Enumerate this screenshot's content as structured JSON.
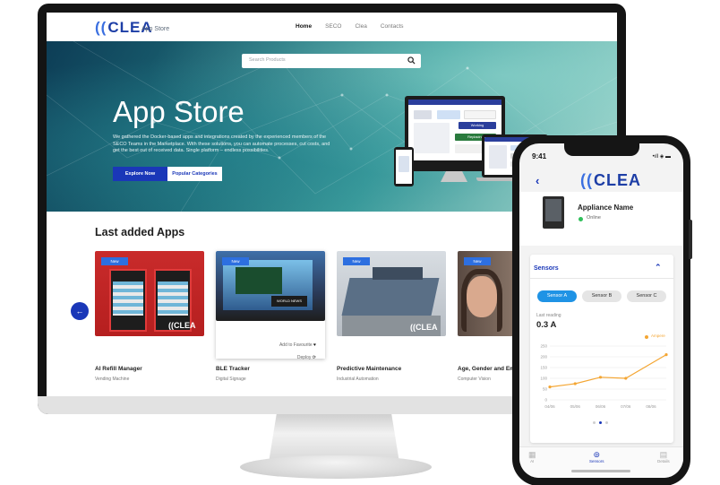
{
  "site": {
    "logo": "CLEA",
    "logo_sub": "App Store",
    "nav": [
      "Home",
      "SECO",
      "Clea",
      "Contacts"
    ],
    "search_placeholder": "Search Products",
    "hero_title": "App Store",
    "hero_desc": "We gathered the Docker-based apps and integrations created by the experienced members of the SECO Teams in the Marketplace. With these solutions, you can automate processes, cut costs, and get the best out of received data. Single platform – endless possibilities.",
    "btn_explore": "Explore Now",
    "btn_categories": "Popular Categories",
    "illustration": {
      "working_label": "Working",
      "replacing_label": "Replacing"
    },
    "section_title": "Last added Apps",
    "badge": "New",
    "add_favourite": "Add to Favourite",
    "deploy": "Deploy",
    "cards": [
      {
        "name": "AI Refill Manager",
        "category": "Vending Machine"
      },
      {
        "name": "BLE Tracker",
        "category": "Digital Signage"
      },
      {
        "name": "Predictive Maintenance",
        "category": "Industrial Automation"
      },
      {
        "name": "Age, Gender and Em",
        "category": "Computer Vision"
      }
    ],
    "colors": {
      "brand": "#1a37b8",
      "accent": "#2d6fe0"
    }
  },
  "phone": {
    "time": "9:41",
    "status": "•ıll ◈ ▬",
    "logo": "CLEA",
    "appliance_name": "Appliance Name",
    "status_text": "Online",
    "sensors_title": "Sensors",
    "tabs": [
      "Sensor A",
      "Sensor B",
      "Sensor C"
    ],
    "last_reading_label": "Last reading",
    "last_reading_value": "0.3 A",
    "legend": "Ampere",
    "nav": [
      {
        "icon": "ai-icon",
        "label": "AI"
      },
      {
        "icon": "sensors-icon",
        "label": "Sensors"
      },
      {
        "icon": "details-icon",
        "label": "Details"
      }
    ]
  },
  "chart_data": {
    "type": "line",
    "x": [
      "04/06",
      "05/06",
      "06/06",
      "07/06",
      "08/06"
    ],
    "x_points": [
      0,
      1,
      2,
      3,
      4,
      4.6
    ],
    "series": [
      {
        "name": "Ampere",
        "values": [
          60,
          75,
          105,
          100,
          210
        ]
      }
    ],
    "yticks": [
      0,
      50,
      100,
      150,
      200,
      250
    ],
    "ylim": [
      0,
      250
    ],
    "legend": "top-right",
    "grid": true
  }
}
